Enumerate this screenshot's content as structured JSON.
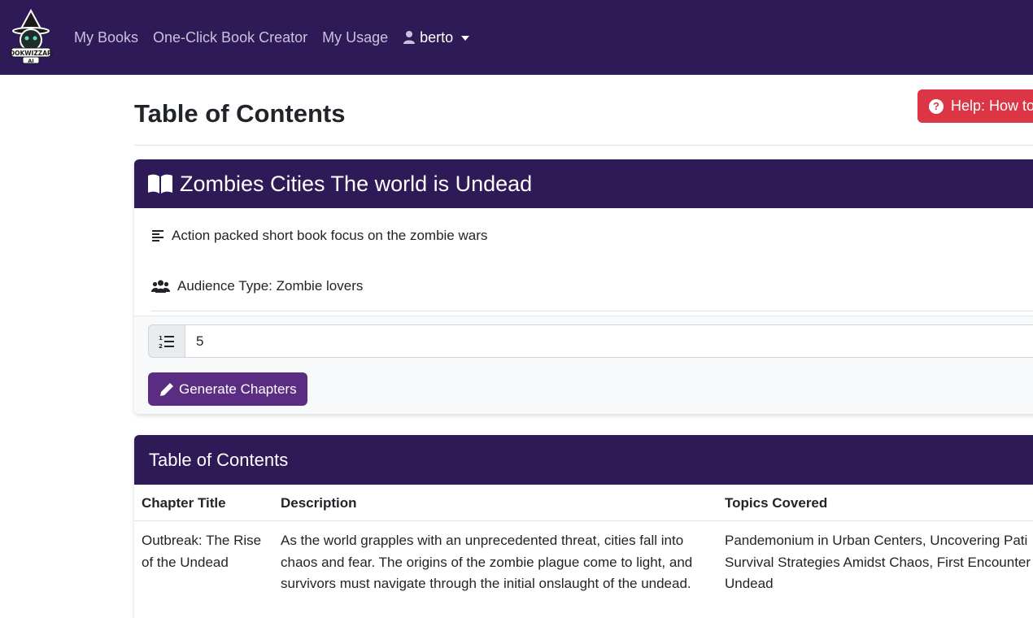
{
  "navbar": {
    "logo_alt": "BOOKWIZZARD AI",
    "links": [
      "My Books",
      "One-Click Book Creator",
      "My Usage"
    ],
    "user": "berto"
  },
  "header": {
    "title": "Table of Contents",
    "help_label": "Help: How to"
  },
  "book": {
    "title": "Zombies Cities The world is Undead",
    "description": "Action packed short book focus on the zombie wars",
    "audience": "Audience Type: Zombie lovers",
    "chapters_count": "5",
    "generate_label": "Generate Chapters"
  },
  "toc": {
    "title": "Table of Contents",
    "columns": [
      "Chapter Title",
      "Description",
      "Topics Covered"
    ],
    "rows": [
      {
        "chapter": "Outbreak: The Rise of the Undead",
        "description": "As the world grapples with an unprecedented threat, cities fall into chaos and fear. The origins of the zombie plague come to light, and survivors must navigate through the initial onslaught of the undead.",
        "topics": "Pandemonium in Urban Centers, Uncovering Pati Survival Strategies Amidst Chaos, First Encounter Undead"
      }
    ]
  },
  "colors": {
    "navbar": "#2e1a57",
    "accent": "#5a2d82",
    "danger": "#dc3545"
  }
}
